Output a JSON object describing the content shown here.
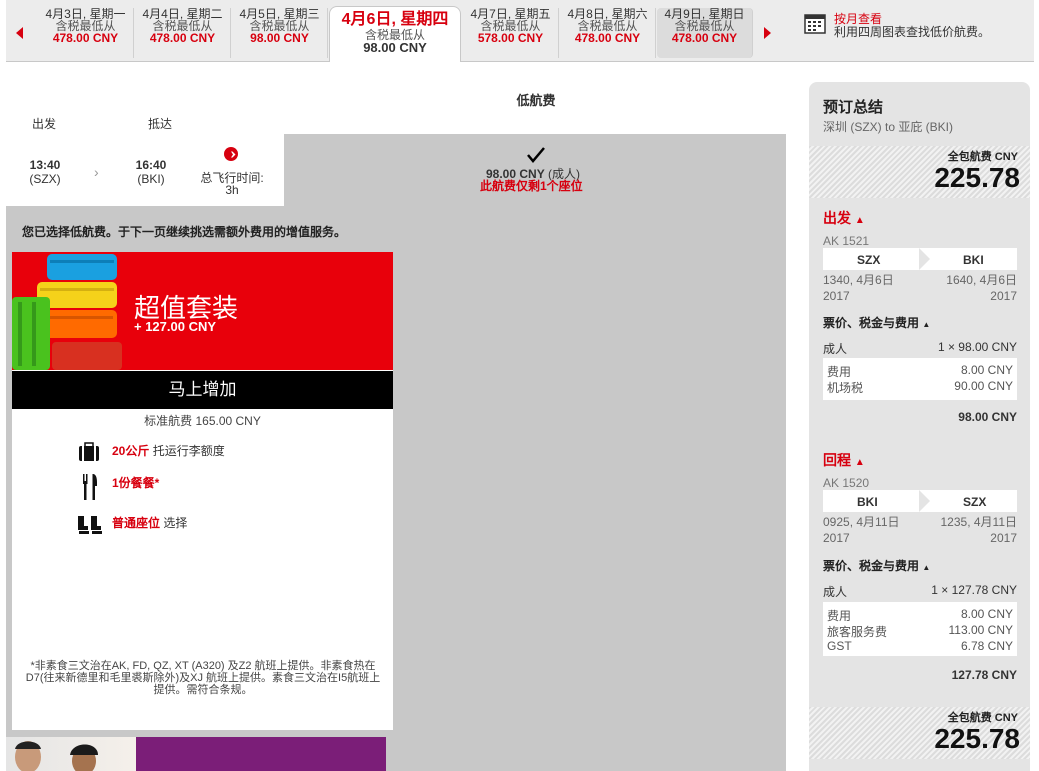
{
  "dates": [
    {
      "date": "4月3日, 星期一",
      "sub": "含税最低从",
      "price": "478.00 CNY"
    },
    {
      "date": "4月4日, 星期二",
      "sub": "含税最低从",
      "price": "478.00 CNY"
    },
    {
      "date": "4月5日, 星期三",
      "sub": "含税最低从",
      "price": "98.00 CNY"
    },
    {
      "date": "4月6日, 星期四",
      "sub": "含税最低从",
      "price": "98.00 CNY"
    },
    {
      "date": "4月7日, 星期五",
      "sub": "含税最低从",
      "price": "578.00 CNY"
    },
    {
      "date": "4月8日, 星期六",
      "sub": "含税最低从",
      "price": "478.00 CNY"
    },
    {
      "date": "4月9日, 星期日",
      "sub": "含税最低从",
      "price": "478.00 CNY"
    }
  ],
  "month_view": {
    "title": "按月查看",
    "desc": "利用四周图表查找低价航费。"
  },
  "fare_header": "低航费",
  "flight": {
    "depart_label": "出发",
    "arrive_label": "抵达",
    "dep_time": "13:40",
    "dep_code": "(SZX)",
    "arr_time": "16:40",
    "arr_code": "(BKI)",
    "duration_label": "总飞行时间:",
    "duration": "3h",
    "fare_price": "98.00 CNY",
    "fare_pax": "(成人)",
    "fare_note": "此航费仅剩1个座位"
  },
  "selected_msg": "您已选择低航费。于下一页继续挑选需额外费用的增值服务。",
  "bundle": {
    "title": "超值套装",
    "price": "+ 127.00 CNY",
    "add_btn": "马上增加",
    "std_label": "标准航费 165.00 CNY",
    "items": [
      {
        "highlight": "20公斤",
        "text": "托运行李额度"
      },
      {
        "highlight": "1份餐餐*",
        "text": ""
      },
      {
        "highlight": "普通座位",
        "text": "选择"
      }
    ],
    "footnote": "*非素食三文治在AK, FD, QZ, XT (A320) 及Z2 航班上提供。非素食热在D7(往来新德里和毛里裘斯除外)及XJ 航班上提供。素食三文治在I5航班上提供。需符合条规。"
  },
  "summary": {
    "title": "预订总结",
    "route": "深圳 (SZX) to 亚庇 (BKI)",
    "total_label": "全包航费 CNY",
    "total": "225.78",
    "outbound": {
      "label": "出发",
      "flight_no": "AK 1521",
      "from": "SZX",
      "to": "BKI",
      "dep": "1340, 4月6日",
      "dep_year": "2017",
      "arr": "1640, 4月6日",
      "arr_year": "2017",
      "fare_label": "票价、税金与费用",
      "pax": "成人",
      "pax_fare": "1 × 98.00 CNY",
      "fees": [
        {
          "name": "费用",
          "value": "8.00 CNY"
        },
        {
          "name": "机场税",
          "value": "90.00 CNY"
        }
      ],
      "subtotal": "98.00 CNY"
    },
    "inbound": {
      "label": "回程",
      "flight_no": "AK 1520",
      "from": "BKI",
      "to": "SZX",
      "dep": "0925, 4月11日",
      "dep_year": "2017",
      "arr": "1235, 4月11日",
      "arr_year": "2017",
      "fare_label": "票价、税金与费用",
      "pax": "成人",
      "pax_fare": "1 × 127.78 CNY",
      "fees": [
        {
          "name": "费用",
          "value": "8.00 CNY"
        },
        {
          "name": "旅客服务费",
          "value": "113.00 CNY"
        },
        {
          "name": "GST",
          "value": "6.78 CNY"
        }
      ],
      "subtotal": "127.78 CNY"
    },
    "total2_label": "全包航费 CNY",
    "total2": "225.78"
  }
}
